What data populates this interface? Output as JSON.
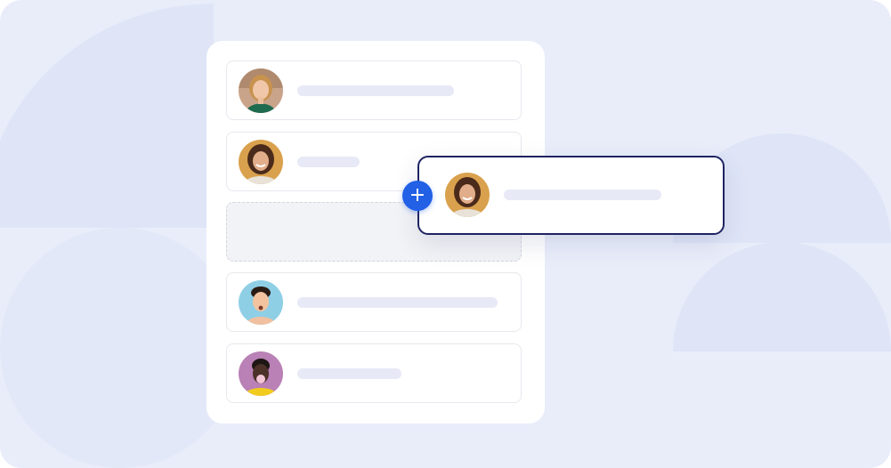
{
  "colors": {
    "background": "#e9edfa",
    "card": "#ffffff",
    "placeholder_bar": "#e8e9f6",
    "accent": "#2260e6",
    "drag_border": "#1f2462"
  },
  "list": {
    "items": [
      {
        "avatar": "woman-smiling-portrait",
        "state": "normal"
      },
      {
        "avatar": "woman-laughing-portrait",
        "state": "normal"
      },
      {
        "avatar": "",
        "state": "drop-placeholder"
      },
      {
        "avatar": "man-surprised-portrait",
        "state": "normal"
      },
      {
        "avatar": "woman-blowing-bubblegum-portrait",
        "state": "normal"
      }
    ]
  },
  "drag_item": {
    "avatar": "woman-laughing-portrait",
    "state": "dragging"
  },
  "add_button": {
    "icon": "plus-icon",
    "glyph": "+"
  }
}
